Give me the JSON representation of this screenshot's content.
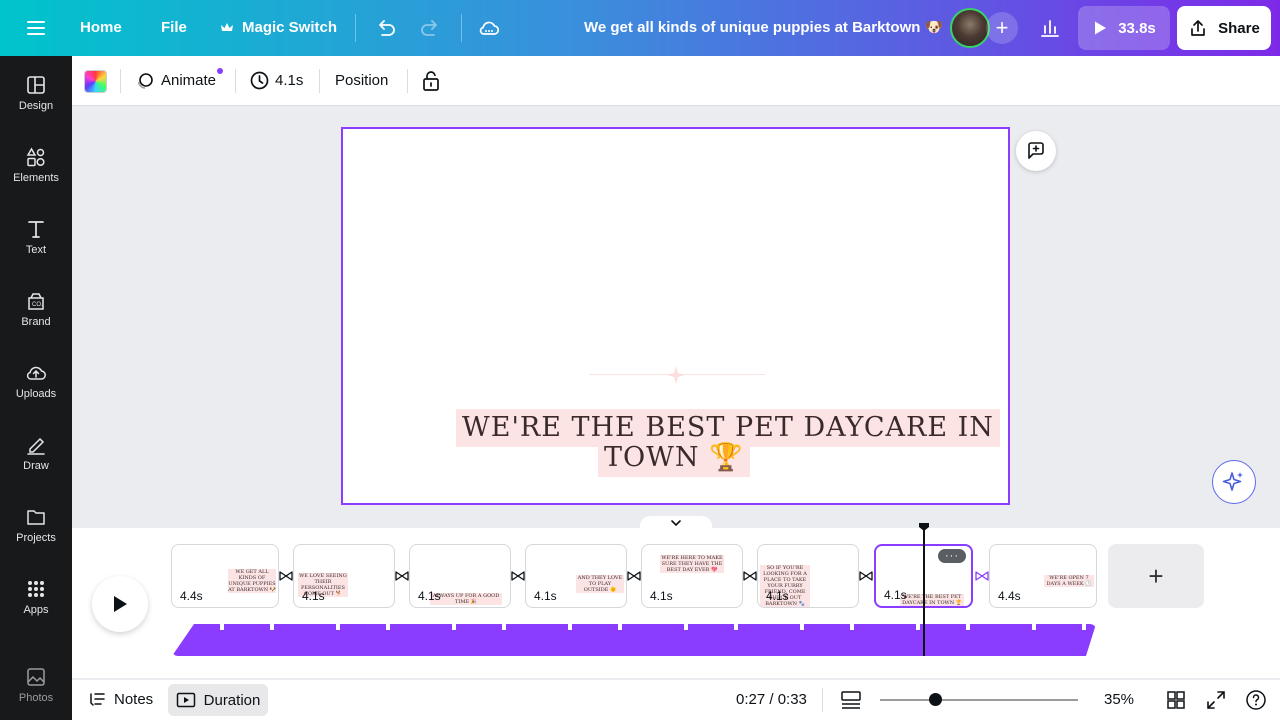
{
  "topbar": {
    "home": "Home",
    "file": "File",
    "magic_switch": "Magic Switch",
    "title": "We get all kinds of unique puppies at Barktown 🐶",
    "present_time": "33.8s",
    "share": "Share"
  },
  "sidebar": {
    "items": [
      {
        "label": "Design",
        "icon": "design-icon"
      },
      {
        "label": "Elements",
        "icon": "elements-icon"
      },
      {
        "label": "Text",
        "icon": "text-icon"
      },
      {
        "label": "Brand",
        "icon": "brand-icon"
      },
      {
        "label": "Uploads",
        "icon": "uploads-icon"
      },
      {
        "label": "Draw",
        "icon": "draw-icon"
      },
      {
        "label": "Projects",
        "icon": "projects-icon"
      },
      {
        "label": "Apps",
        "icon": "apps-icon"
      },
      {
        "label": "Photos",
        "icon": "photos-icon"
      }
    ]
  },
  "toolbar": {
    "animate": "Animate",
    "duration": "4.1s",
    "position": "Position"
  },
  "canvas": {
    "line1": "WE'RE THE BEST PET DAYCARE IN",
    "line2": "TOWN 🏆",
    "accent": "#8b3dff",
    "highlight": "#fce4e4"
  },
  "timeline": {
    "clips": [
      {
        "duration": "4.4s",
        "text": "We get all kinds of unique puppies at Barktown 🐶"
      },
      {
        "duration": "4.1s",
        "text": "We love seeing their personalities come out 🐕"
      },
      {
        "duration": "4.1s",
        "text": "Always up for a good time 🎉"
      },
      {
        "duration": "4.1s",
        "text": "And they love to play outside 🌞"
      },
      {
        "duration": "4.1s",
        "text": "We're here to make sure they have the best day ever 💖"
      },
      {
        "duration": "4.1s",
        "text": "So if you're looking for a place to take your furry friend, come check out Barktown 🐾"
      },
      {
        "duration": "4.1s",
        "text": "We're the best pet daycare in town 🏆",
        "selected": true
      },
      {
        "duration": "4.4s",
        "text": "We're open 7 days a week 🕐"
      }
    ],
    "more": "···"
  },
  "bottombar": {
    "notes": "Notes",
    "duration": "Duration",
    "time": "0:27 / 0:33",
    "zoom": "35%",
    "zoom_level": 0.28
  }
}
